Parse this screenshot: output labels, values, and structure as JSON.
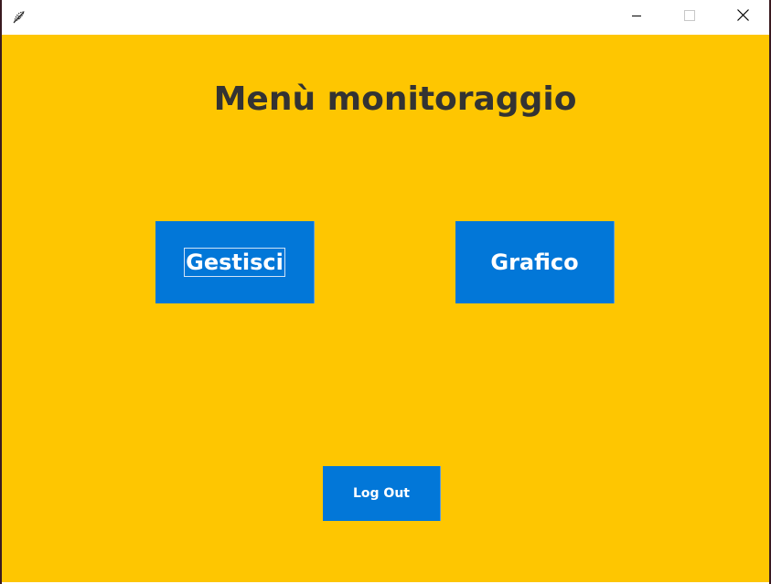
{
  "window": {
    "app_icon": "feather-icon",
    "controls": {
      "minimize_icon": "minimize-icon",
      "maximize_icon": "maximize-icon",
      "close_icon": "close-icon"
    }
  },
  "main": {
    "title": "Menù monitoraggio",
    "buttons": {
      "gestisci": "Gestisci",
      "grafico": "Grafico",
      "logout": "Log Out"
    }
  },
  "colors": {
    "background": "#fec601",
    "button": "#0277d8",
    "button_text": "#ffffff",
    "title_text": "#333333"
  }
}
